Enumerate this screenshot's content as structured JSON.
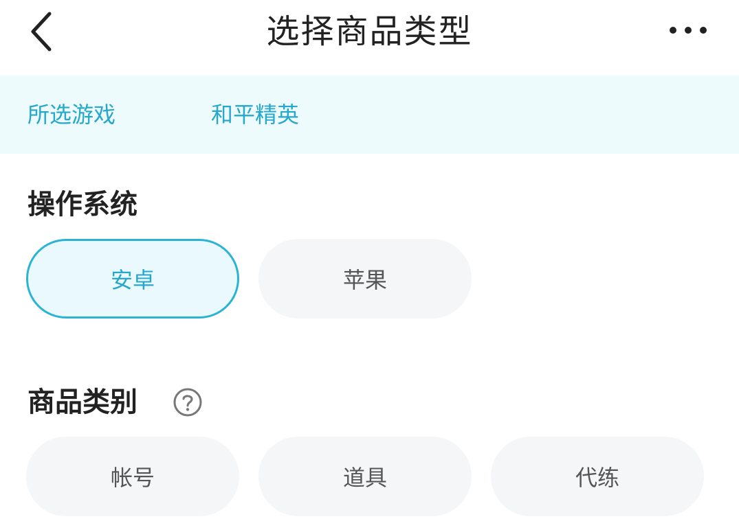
{
  "header": {
    "title": "选择商品类型",
    "back_icon": "chevron-left-icon",
    "more_icon": "more-dots-icon"
  },
  "game": {
    "label": "所选游戏",
    "name": "和平精英"
  },
  "os_section": {
    "title": "操作系统",
    "options": [
      {
        "label": "安卓",
        "selected": true
      },
      {
        "label": "苹果",
        "selected": false
      }
    ]
  },
  "category_section": {
    "title": "商品类别",
    "help_icon": "question-circle-icon",
    "options": [
      {
        "label": "帐号",
        "selected": false
      },
      {
        "label": "道具",
        "selected": false
      },
      {
        "label": "代练",
        "selected": false
      }
    ]
  },
  "colors": {
    "accent": "#26a7cc",
    "accent_border": "#2bb3d3",
    "banner_bg": "#eefbfd",
    "pill_bg": "#f5f6f8",
    "selected_bg": "#e9f9fd"
  }
}
